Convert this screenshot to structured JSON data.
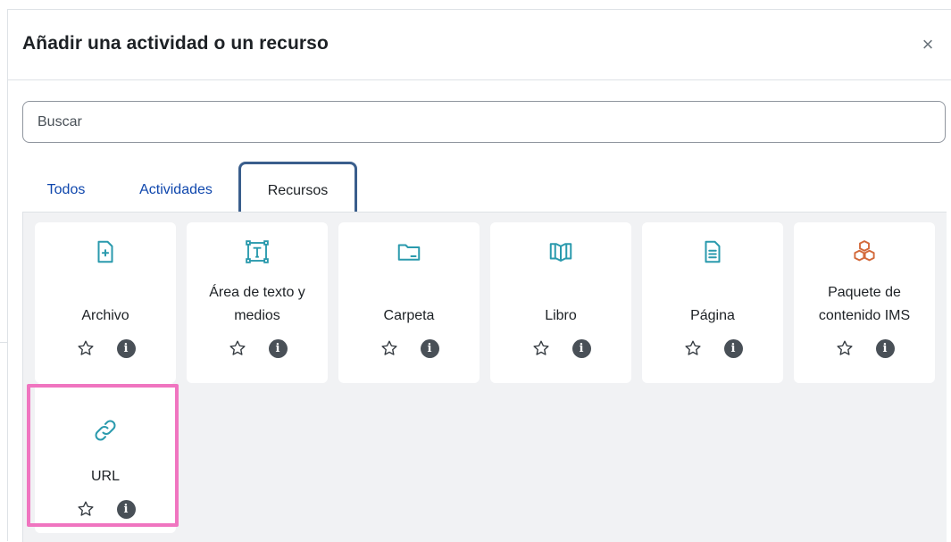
{
  "dialog": {
    "title": "Añadir una actividad o un recurso",
    "close_symbol": "×"
  },
  "search": {
    "placeholder": "Buscar"
  },
  "tabs": [
    {
      "label": "Todos",
      "active": false
    },
    {
      "label": "Actividades",
      "active": false
    },
    {
      "label": "Recursos",
      "active": true
    }
  ],
  "items": [
    {
      "label": "Archivo",
      "icon": "file-plus-icon"
    },
    {
      "label": "Área de texto y medios",
      "icon": "text-area-icon"
    },
    {
      "label": "Carpeta",
      "icon": "folder-icon"
    },
    {
      "label": "Libro",
      "icon": "book-icon"
    },
    {
      "label": "Página",
      "icon": "page-icon"
    },
    {
      "label": "Paquete de contenido IMS",
      "icon": "package-icon"
    },
    {
      "label": "URL",
      "icon": "link-icon",
      "highlighted": true
    }
  ],
  "colors": {
    "accent_teal": "#2a9aad",
    "package_orange": "#d3693a",
    "tab_link": "#0f47ad",
    "active_tab_border": "#3a5e8c",
    "highlight": "#f075c0",
    "info_icon": "#495057"
  }
}
